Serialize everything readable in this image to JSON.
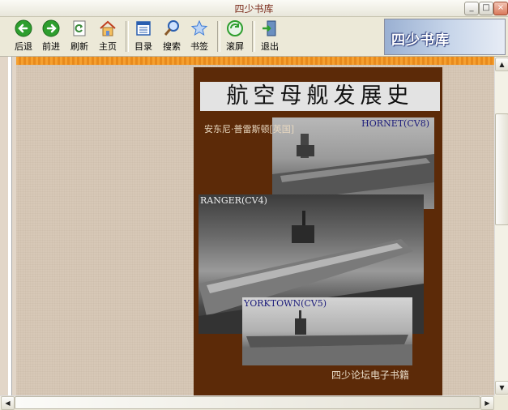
{
  "window": {
    "title": "四少书库",
    "controls": {
      "minimize": "_",
      "maximize": "□",
      "close": "×"
    }
  },
  "toolbar": {
    "buttons": [
      {
        "id": "back",
        "label": "后退",
        "icon": "back-arrow-icon",
        "color": "#2e9e2e"
      },
      {
        "id": "forward",
        "label": "前进",
        "icon": "forward-arrow-icon",
        "color": "#2e9e2e"
      },
      {
        "id": "refresh",
        "label": "刷新",
        "icon": "refresh-icon",
        "color": "#3a8a3a"
      },
      {
        "id": "home",
        "label": "主页",
        "icon": "home-icon",
        "color": "#e0a030"
      },
      {
        "id": "contents",
        "label": "目录",
        "icon": "contents-icon",
        "color": "#2a5fb0"
      },
      {
        "id": "search",
        "label": "搜索",
        "icon": "magnifier-icon",
        "color": "#2a5fb0"
      },
      {
        "id": "bookmark",
        "label": "书签",
        "icon": "star-icon",
        "color": "#3c7ad6"
      },
      {
        "id": "scroll",
        "label": "滚屏",
        "icon": "scroll-icon",
        "color": "#2e9e2e"
      },
      {
        "id": "exit",
        "label": "退出",
        "icon": "exit-icon",
        "color": "#3a6a9a"
      }
    ],
    "logo_text": "四少书库"
  },
  "cover": {
    "title": "航空母舰发展史",
    "author": "安东尼·普雷斯顿[英国]",
    "photos": [
      {
        "caption": "HORNET(CV8)"
      },
      {
        "caption": "RANGER(CV4)"
      },
      {
        "caption": "YORKTOWN(CV5)"
      }
    ],
    "footer": "四少论坛电子书籍"
  },
  "scrollbars": {
    "up": "▲",
    "down": "▼",
    "left": "◀",
    "right": "▶"
  }
}
